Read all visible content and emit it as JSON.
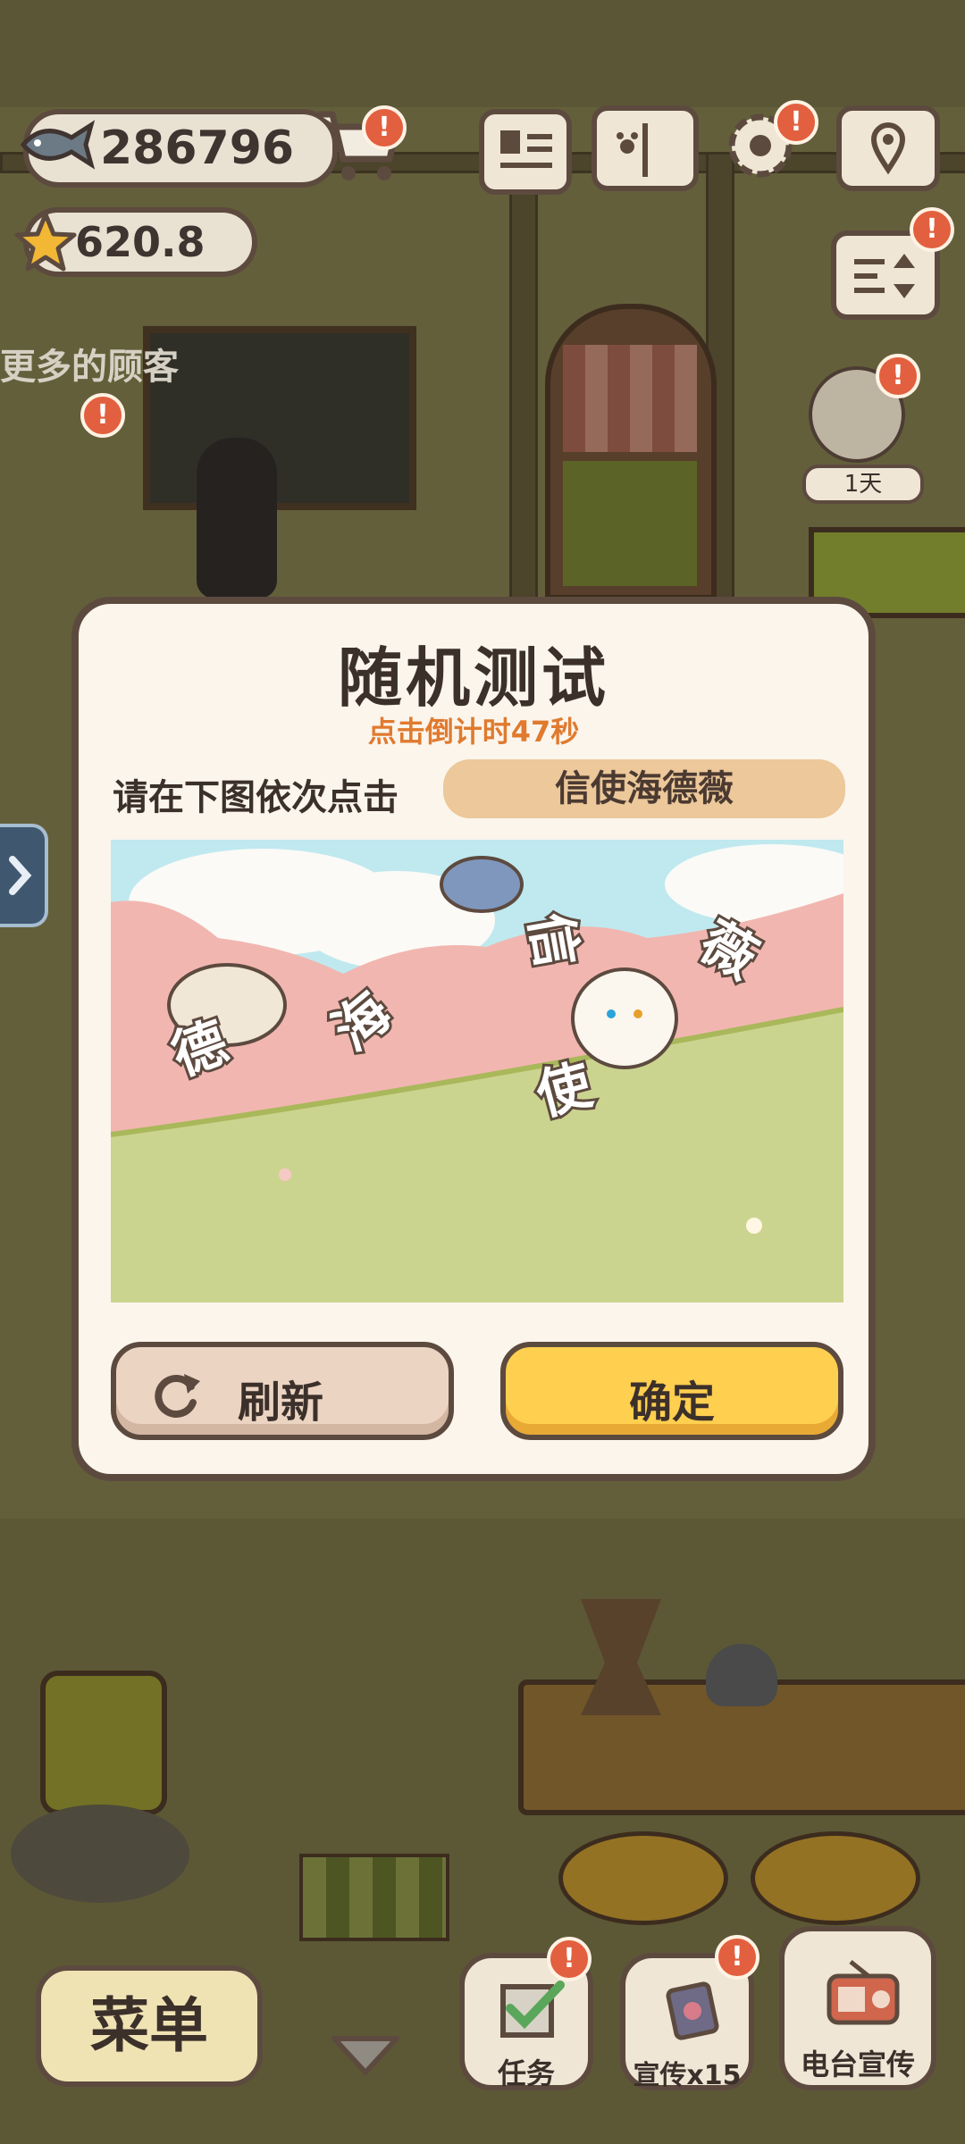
{
  "hud": {
    "fish_count": "286796",
    "star_count": "620.8",
    "more_customers_text": "更多的顾客",
    "day_label": "1天",
    "badge_symbol": "!"
  },
  "modal": {
    "title": "随机测试",
    "countdown": "点击倒计时47秒",
    "prompt": "请在下图依次点击",
    "target_word": "信使海德薇",
    "refresh_label": "刷新",
    "confirm_label": "确定"
  },
  "captcha": {
    "glyphs": [
      "德",
      "海",
      "信",
      "使",
      "薇"
    ]
  },
  "bottom_bar": {
    "menu_label": "菜单",
    "task_label": "任务",
    "promo_label": "宣传x15",
    "radio_label": "电台宣传"
  },
  "colors": {
    "accent_orange": "#e07a2f",
    "confirm_yellow": "#ffcf4f",
    "refresh_pink": "#ecd4c3",
    "badge_red": "#e2603f",
    "border_brown": "#5d4a3f"
  }
}
